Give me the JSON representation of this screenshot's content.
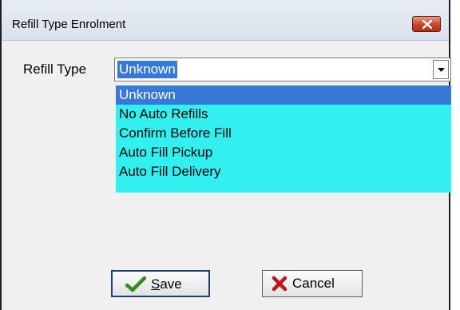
{
  "window": {
    "title": "Refill Type Enrolment"
  },
  "form": {
    "refill_type_label": "Refill Type",
    "refill_type_value": "Unknown",
    "options": [
      "Unknown",
      "No Auto Refills",
      "Confirm Before Fill",
      "Auto Fill Pickup",
      "Auto Fill Delivery"
    ],
    "selected_option": "Unknown"
  },
  "buttons": {
    "save": {
      "mnemonic": "S",
      "rest": "ave",
      "icon": "checkmark-icon"
    },
    "cancel": {
      "label": "Cancel",
      "icon": "x-icon"
    }
  },
  "icons": {
    "close": "close-icon",
    "dropdown": "chevron-down-icon"
  },
  "colors": {
    "selection": "#3779d7",
    "dropdown_bg": "#33f0f0",
    "close_button": "#c4442c",
    "check_green": "#2f8f1c",
    "cancel_red": "#c0141e"
  }
}
